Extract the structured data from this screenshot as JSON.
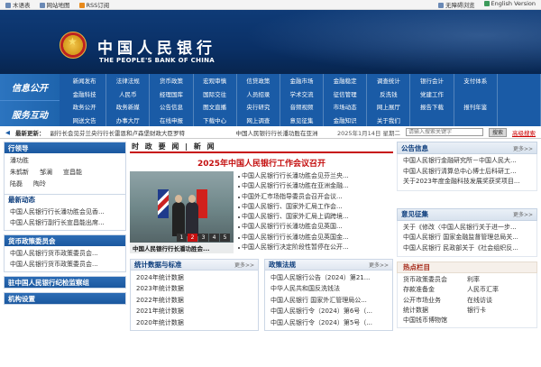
{
  "util": {
    "left": [
      "木语表",
      "网站地图",
      "RSS订阅"
    ],
    "right": [
      "无障碍浏览",
      "English Version"
    ]
  },
  "banner": {
    "title_cn": "中国人民银行",
    "title_en": "THE PEOPLE'S BANK OF CHINA"
  },
  "nav": {
    "label_info": "信息公开",
    "label_service": "服务互动",
    "items": [
      "新闻发布",
      "法律法规",
      "货币政策",
      "宏观审慎",
      "信贷政策",
      "金融市场",
      "金融稳定",
      "调查统计",
      "银行会计",
      "支付体系",
      "",
      "金融科技",
      "人民币",
      "经理国库",
      "国际交往",
      "人员招录",
      "学术交流",
      "征信管理",
      "反洗钱",
      "党建工作",
      "",
      "",
      "政务公开",
      "政务新媒",
      "公告信息",
      "图文直播",
      "央行研究",
      "音频视频",
      "市场动态",
      "网上展厅",
      "报告下载",
      "报刊年鉴",
      "",
      "网送文告",
      "办事大厅",
      "在线申报",
      "下载中心",
      "网上调查",
      "意见征集",
      "金融知识",
      "关于我们",
      "",
      "",
      ""
    ]
  },
  "ticker": {
    "label": "最新更新：",
    "news1": "副行长会见芬兰央行行长雷恩和卢森堡财政大臣罗特",
    "news2": "中国人民银行行长潘功胜在亚洲",
    "date": "2025年1月14日 星期二",
    "search_placeholder": "请输入搜索关键字",
    "search_btn": "搜索",
    "advanced": "高级搜索"
  },
  "leaders": {
    "title": "行领导",
    "rows": [
      [
        "潘功胜"
      ],
      [
        "朱鹤新",
        "邹澜",
        "宣昌能"
      ],
      [
        "陆磊",
        "陶玲"
      ]
    ]
  },
  "latest": {
    "title": "最新动态",
    "items": [
      "中国人民银行行长潘功胜会见香...",
      "中国人民银行副行长宣昌能出席..."
    ]
  },
  "committee": {
    "title": "货币政策委员会",
    "items": [
      "中国人民银行货币政策委员会...",
      "中国人民银行货币政策委员会..."
    ]
  },
  "discipline": {
    "title": "驻中国人民银行纪检监察组"
  },
  "org": {
    "title": "机构设置"
  },
  "middle": {
    "header": "时 政 要 闻 | 新 闻",
    "feature_title": "2025年中国人民银行工作会议召开",
    "photo_caption": "中国人民银行行长潘功胜会...",
    "dots": [
      "1",
      "2",
      "3",
      "4",
      "5"
    ],
    "feature_list": [
      "中国人民银行行长潘功胜会见芬兰央...",
      "中国人民银行行长潘功胜在亚洲金融...",
      "中国外汇市场指导委员会召开会议...",
      "中国人民银行、国家外汇局工作会...",
      "中国人民银行、国家外汇局上调跨境...",
      "中国人民银行行长潘功胜会见英国...",
      "中国人民银行行长潘功胜会见英国金...",
      "中国人民银行决定阶段性暂停在公开..."
    ]
  },
  "stats": {
    "title": "统计数据与标准",
    "more": "更多>>",
    "items": [
      "2024年统计数据",
      "2023年统计数据",
      "2022年统计数据",
      "2021年统计数据",
      "2020年统计数据"
    ]
  },
  "laws": {
    "title": "政策法规",
    "more": "更多>>",
    "items": [
      "中国人民银行公告（2024）第21...",
      "中华人民共和国反洗钱法",
      "中国人民银行 国家外汇管理局公...",
      "中国人民银行令（2024）第6号（...",
      "中国人民银行令（2024）第5号（..."
    ]
  },
  "notices": {
    "title": "公告信息",
    "more": "更多>>",
    "items": [
      "中国人民银行金融研究所－中国人民大...",
      "中国人民银行清算总中心博士后科研工...",
      "关于2023年度金融科技发展奖获奖项目..."
    ]
  },
  "opinions": {
    "title": "意见征集",
    "more": "更多>>",
    "items": [
      "关于《修改〈中国人民银行关于进一步...",
      "中国人民银行 国家金融监督管理总局关...",
      "中国人民银行 民政部关于《社会组织反..."
    ]
  },
  "hot": {
    "title": "热点栏目",
    "items": [
      "货币政策委员会",
      "利率",
      "存款准备金",
      "人民币汇率",
      "公开市场业务",
      "在线访谈",
      "统计数据",
      "银行卡",
      "中国钱币博物馆",
      ""
    ]
  }
}
